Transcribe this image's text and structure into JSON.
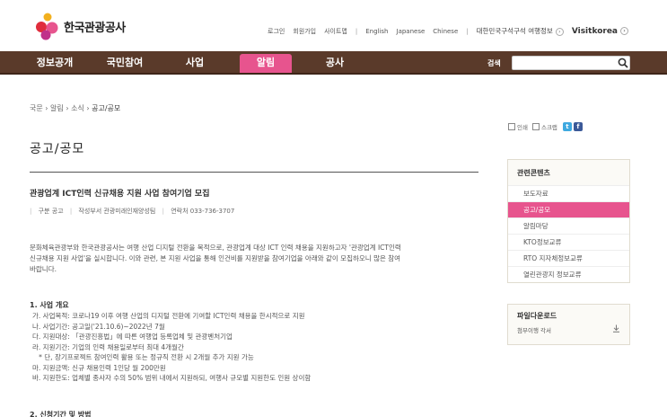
{
  "brand": {
    "name": "한국관광공사",
    "accent": "#e7548e",
    "nav_bg": "#5a3a2a"
  },
  "top_links": {
    "login": "로그인",
    "join": "회원가입",
    "sitemap": "사이트맵",
    "english": "English",
    "japanese": "Japanese",
    "chinese": "Chinese",
    "site_info": "대한민국구석구석 여행정보",
    "visitkorea": "Visitkorea",
    "arrow": "›"
  },
  "nav": {
    "items": [
      "정보공개",
      "국민참여",
      "사업",
      "알림",
      "공사"
    ],
    "active_index": 3,
    "search_label": "검색"
  },
  "breadcrumb": [
    "국문",
    "알림",
    "소식",
    "공고/공모"
  ],
  "breadcrumb_sep": "›",
  "page_title": "공고/공모",
  "post": {
    "title": "관광업계 ICT인력 신규채용 지원 사업 참여기업 모집",
    "category_label": "구분 공고",
    "author_label": "작성부서 관광미래인재양성팀",
    "contact_label": "연락처 033-736-3707",
    "intro_1": "문화체육관광부와 한국관광공사는 여행 산업 디지털 전환을 목적으로, 관광업계 대상 ICT 인력 채용을 지원하고자 '관광업계 ICT인력",
    "intro_2": "신규채용 지원 사업'을 실시합니다. 이와 관련, 본 지원 사업을 통해 인건비를 지원받을 참여기업을 아래와 같이 모집하오니 많은 참여",
    "intro_3": "바랍니다.",
    "section1": "1. 사업 개요",
    "lines": [
      "가. 사업목적: 코로나19 이후 여행 산업의 디지털 전환에 기여할 ICT인력 채용을 한시적으로 지원",
      "나. 사업기간: 공고일('21.10.6)~2022년 7월",
      "다. 지원대상: 「관광진흥법」에 따른 여행업 등록업체 및 관광벤처기업",
      "라. 지원기간: 기업의 인력 채용일로부터 최대 4개월간",
      "   * 단, 장기프로젝트 참여인력 활용 또는 정규직 전환 시 2개월 추가 지원 가능",
      "마. 지원금액: 신규 채용인력 1인당 월 200만원",
      "바. 지원한도: 업체별 종사자 수의 50% 범위 내에서 지원하되, 여행사 규모별 지원한도 인원 상이함"
    ],
    "section2": "2. 신청기간 및 방법"
  },
  "share": {
    "print": "인쇄",
    "scrap": "스크랩",
    "twitter": "t",
    "facebook": "f"
  },
  "sidebar": {
    "heading": "관련콘텐츠",
    "items": [
      "보도자료",
      "공고/공모",
      "알림마당",
      "KTO정보교류",
      "RTO 지자체정보교류",
      "열린관광지 정보교류"
    ],
    "active_index": 1
  },
  "download": {
    "heading": "파일다운로드",
    "file": "첨부이행 각서",
    "icon": "download-icon"
  }
}
